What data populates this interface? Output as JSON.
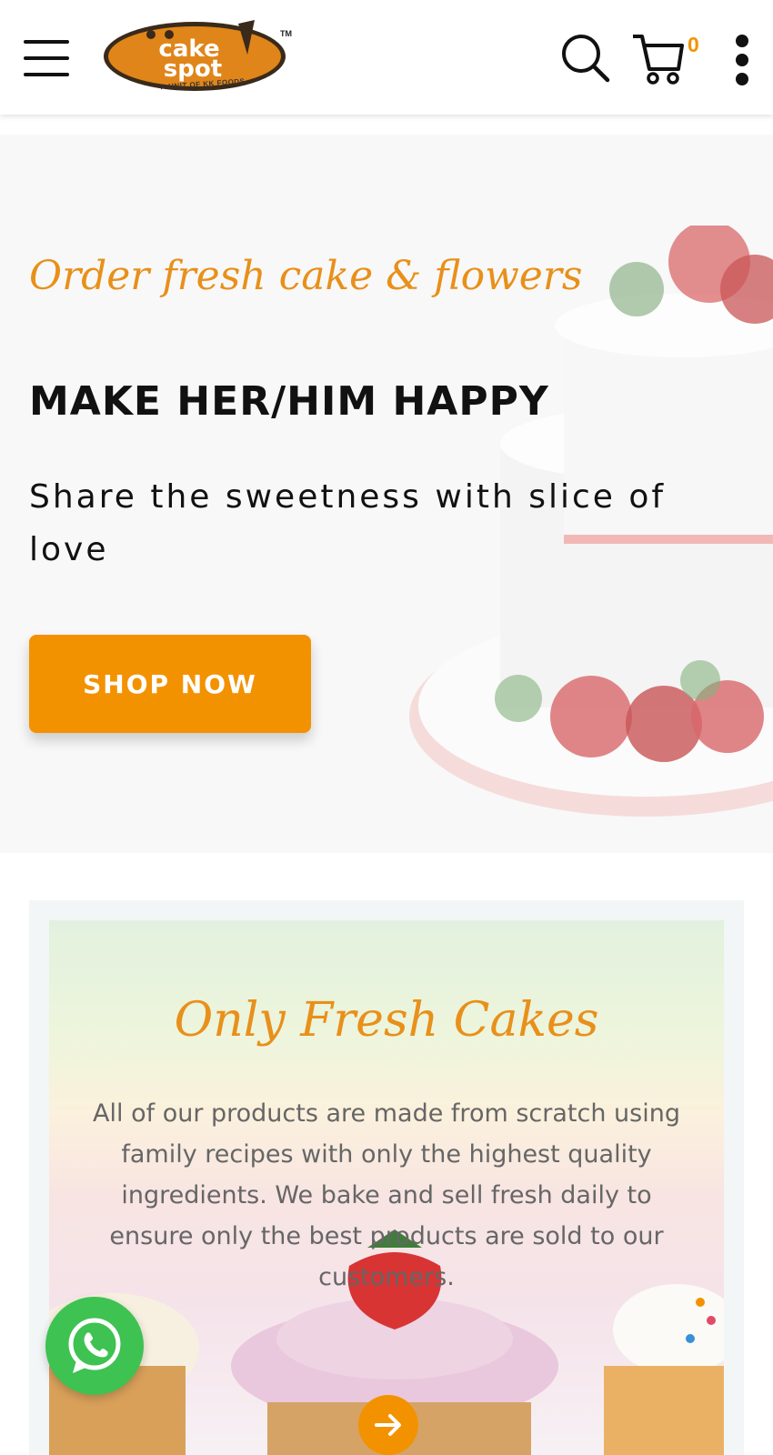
{
  "colors": {
    "accent": "#f39200",
    "script_text": "#e8901a",
    "whatsapp": "#3ec252"
  },
  "header": {
    "logo_text_line1": "cake",
    "logo_text_line2": "spot",
    "logo_subtitle": "A UNIT OF KK FOODS",
    "logo_tm": "TM",
    "cart_count": "0",
    "icons": [
      "menu-icon",
      "search-icon",
      "cart-icon",
      "more-vert-icon"
    ]
  },
  "hero": {
    "tagline": "Order fresh cake & flowers",
    "title": "MAKE HER/HIM HAPPY",
    "subtitle": "Share the sweetness with slice of love",
    "button_label": "SHOP NOW"
  },
  "fresh": {
    "title": "Only Fresh Cakes",
    "text": "All of our products are made from scratch using family recipes with only the highest quality ingredients. We bake and sell fresh daily to ensure only the best products are sold to our customers."
  },
  "floating": {
    "icons": [
      "whatsapp-icon",
      "arrow-right-icon"
    ]
  }
}
